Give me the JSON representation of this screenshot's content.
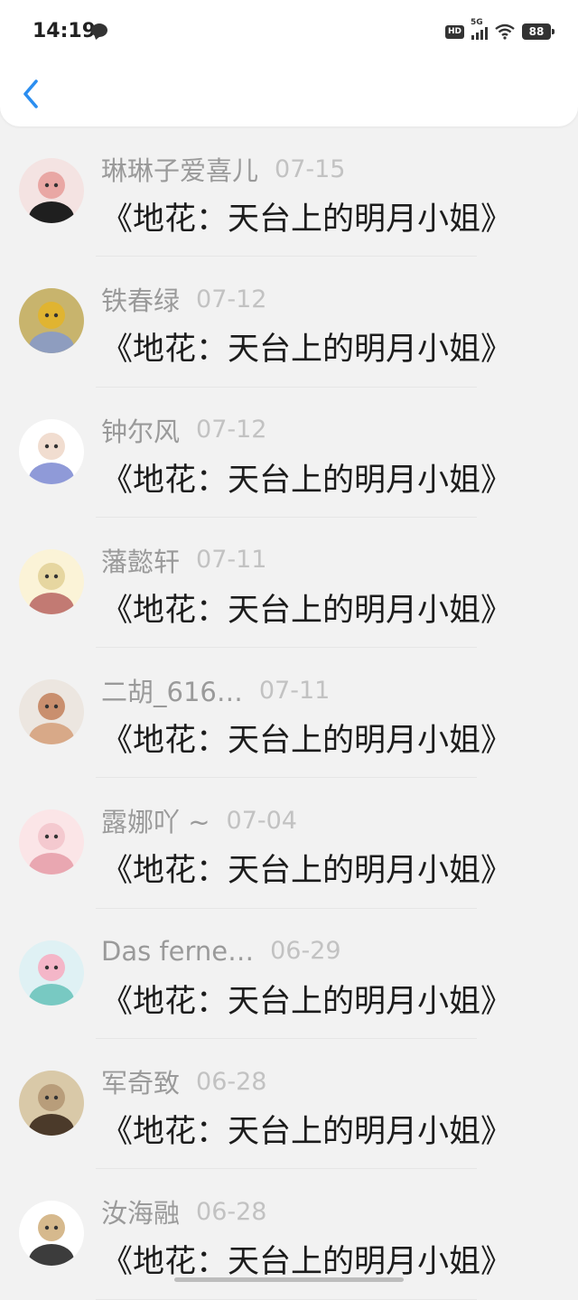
{
  "status_bar": {
    "time": "14:19",
    "network": "5G",
    "hd": "HD",
    "battery": "88"
  },
  "header": {
    "back_icon": "chevron-left-icon",
    "accent": "#2b8ef0"
  },
  "items": [
    {
      "name": "琳琳子爱喜儿",
      "date": "07-15",
      "title": "《地花：天台上的明月小姐》",
      "avatar": {
        "bg": "#f4e3e2",
        "fg": "#1f1f1f",
        "accent": "#e9a7a4"
      }
    },
    {
      "name": "铁春绿",
      "date": "07-12",
      "title": "《地花：天台上的明月小姐》",
      "avatar": {
        "bg": "#c8b46d",
        "fg": "#8e9dbf",
        "accent": "#e0b431"
      }
    },
    {
      "name": "钟尔风",
      "date": "07-12",
      "title": "《地花：天台上的明月小姐》",
      "avatar": {
        "bg": "#ffffff",
        "fg": "#8f9ad8",
        "accent": "#f1ddd0"
      }
    },
    {
      "name": "藩懿轩",
      "date": "07-11",
      "title": "《地花：天台上的明月小姐》",
      "avatar": {
        "bg": "#fbf3d7",
        "fg": "#c27a73",
        "accent": "#e6d6a0"
      }
    },
    {
      "name": "二胡_616…",
      "date": "07-11",
      "title": "《地花：天台上的明月小姐》",
      "avatar": {
        "bg": "#ece6e0",
        "fg": "#d8a988",
        "accent": "#c98f6e"
      }
    },
    {
      "name": "露娜吖 ~",
      "date": "07-04",
      "title": "《地花：天台上的明月小姐》",
      "avatar": {
        "bg": "#fbe5e7",
        "fg": "#e9a7b1",
        "accent": "#f4c9cf"
      }
    },
    {
      "name": "Das ferne…",
      "date": "06-29",
      "title": "《地花：天台上的明月小姐》",
      "avatar": {
        "bg": "#dff1f4",
        "fg": "#78c9c2",
        "accent": "#f4b6c8"
      }
    },
    {
      "name": "军奇致",
      "date": "06-28",
      "title": "《地花：天台上的明月小姐》",
      "avatar": {
        "bg": "#d9c9a8",
        "fg": "#4b3a2a",
        "accent": "#b89d7a"
      }
    },
    {
      "name": "汝海融",
      "date": "06-28",
      "title": "《地花：天台上的明月小姐》",
      "avatar": {
        "bg": "#ffffff",
        "fg": "#3c3c3c",
        "accent": "#d6b98d"
      }
    }
  ]
}
